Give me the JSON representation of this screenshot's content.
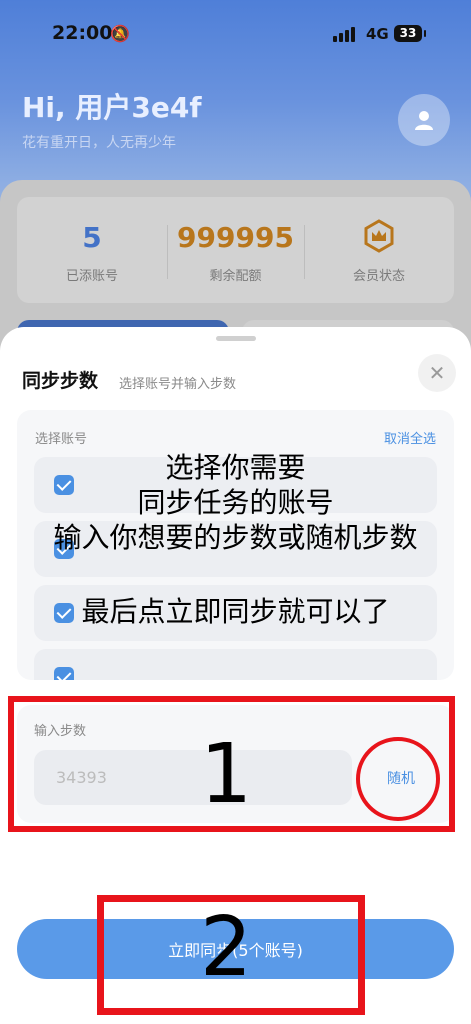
{
  "status_bar": {
    "time": "22:00",
    "network": "4G",
    "battery": "33"
  },
  "header": {
    "greeting": "Hi, 用户3e4f",
    "motto": "花有重开日，人无再少年"
  },
  "stats": [
    {
      "value": "5",
      "label": "已添账号",
      "color": "#4372c7"
    },
    {
      "value": "999995",
      "label": "剩余配额",
      "color": "#b8761c"
    },
    {
      "value": "",
      "label": "会员状态",
      "color": "#b8761c"
    }
  ],
  "sheet": {
    "title": "同步步数",
    "subtitle": "选择账号并输入步数",
    "accounts_label": "选择账号",
    "deselect_all": "取消全选",
    "steps_label": "输入步数",
    "steps_placeholder": "34393",
    "random_label": "随机",
    "sync_button": "立即同步(5个账号)"
  },
  "annotations": {
    "instruction_lines": [
      "选择你需要",
      "同步任务的账号",
      "输入你想要的步数或随机步数",
      "最后点立即同步就可以了"
    ],
    "marker_1": "1",
    "marker_2": "2"
  },
  "colors": {
    "accent": "#4a90e2",
    "annotation_red": "#e8141b",
    "sync_button": "#5a9ae8"
  }
}
